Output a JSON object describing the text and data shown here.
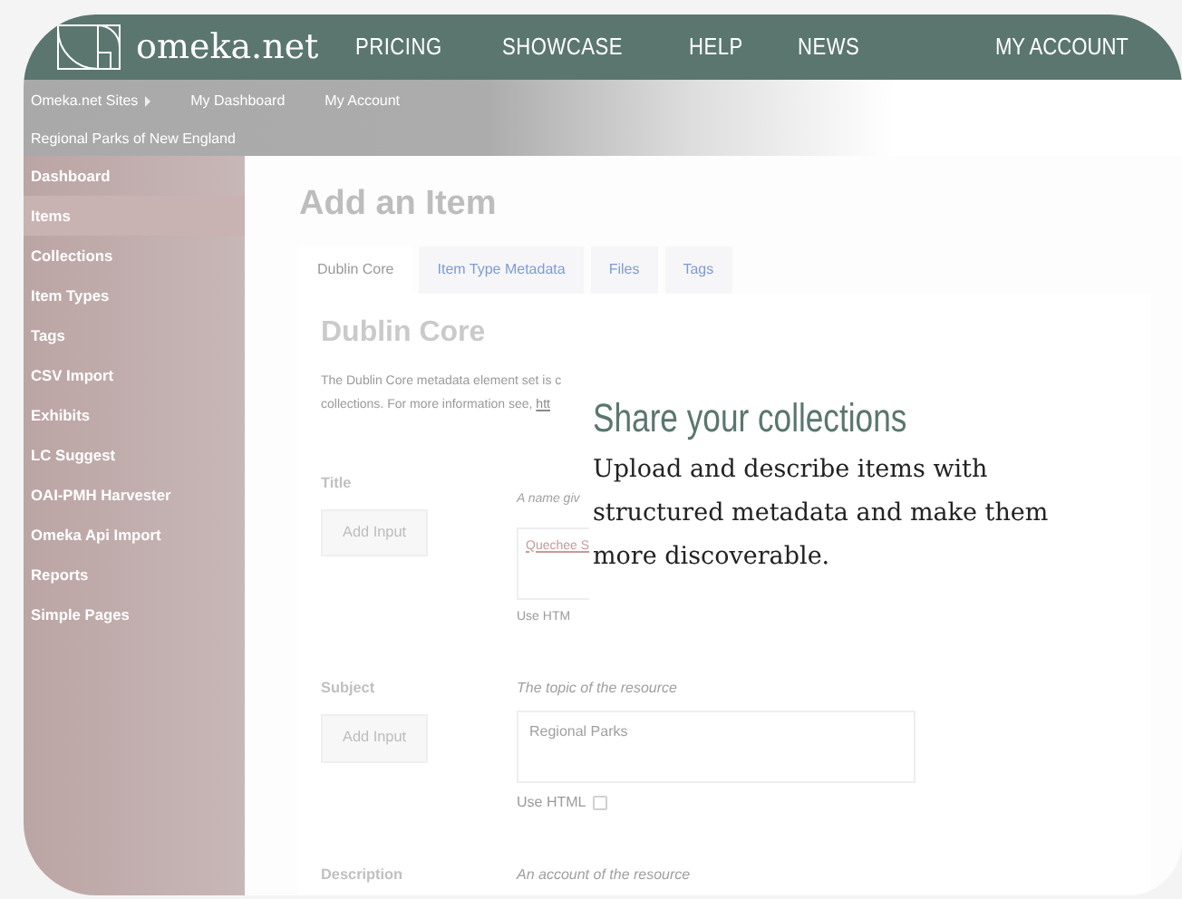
{
  "header": {
    "logo": "omeka.net",
    "nav": [
      {
        "label": "PRICING"
      },
      {
        "label": "SHOWCASE"
      },
      {
        "label": "HELP"
      },
      {
        "label": "NEWS"
      }
    ],
    "account": "MY ACCOUNT"
  },
  "admin_bar": {
    "links": [
      {
        "label": "Omeka.net Sites",
        "has_caret": true
      },
      {
        "label": "My Dashboard",
        "has_caret": false
      },
      {
        "label": "My Account",
        "has_caret": false
      }
    ],
    "site_title": "Regional Parks of New England"
  },
  "sidebar": {
    "items": [
      {
        "label": "Dashboard",
        "selected": false
      },
      {
        "label": "Items",
        "selected": true
      },
      {
        "label": "Collections",
        "selected": false
      },
      {
        "label": "Item Types",
        "selected": false
      },
      {
        "label": "Tags",
        "selected": false
      },
      {
        "label": "CSV Import",
        "selected": false
      },
      {
        "label": "Exhibits",
        "selected": false
      },
      {
        "label": "LC Suggest",
        "selected": false
      },
      {
        "label": "OAI-PMH Harvester",
        "selected": false
      },
      {
        "label": "Omeka Api Import",
        "selected": false
      },
      {
        "label": "Reports",
        "selected": false
      },
      {
        "label": "Simple Pages",
        "selected": false
      }
    ]
  },
  "main": {
    "heading": "Add an Item",
    "tabs": [
      {
        "label": "Dublin Core",
        "selected": true
      },
      {
        "label": "Item Type Metadata",
        "selected": false
      },
      {
        "label": "Files",
        "selected": false
      },
      {
        "label": "Tags",
        "selected": false
      }
    ],
    "section_title": "Dublin Core",
    "description": [
      "The Dublin Core metadata element set is c",
      "collections. For more information see, "
    ],
    "description_link": "htt",
    "fields": [
      {
        "label": "Title",
        "hint": "A name giv",
        "button": "Add Input",
        "value": "Quechee S",
        "use_html": "Use HTM"
      },
      {
        "label": "Subject",
        "hint": "The topic of the resource",
        "button": "Add Input",
        "value": "Regional Parks",
        "use_html": "Use HTML",
        "use_html_checked": false
      },
      {
        "label": "Description",
        "hint": "An account of the resource"
      }
    ]
  },
  "promo": {
    "title": "Share your collections",
    "body": "Upload and describe items with structured metadata and make them more discoverable."
  }
}
